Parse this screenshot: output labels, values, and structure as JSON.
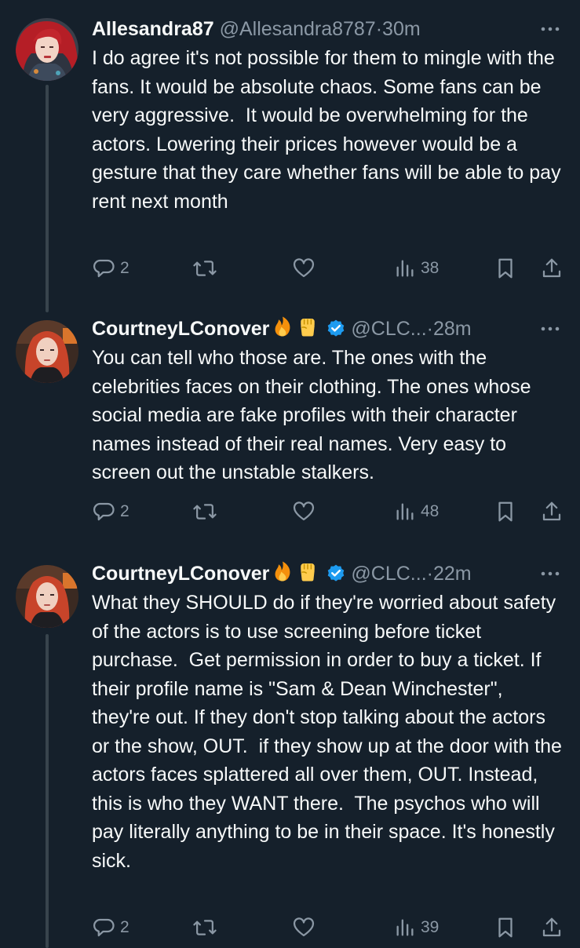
{
  "colors": {
    "background": "#15202b",
    "text": "#f7f9f9",
    "secondary_text": "#8b98a5",
    "verified_badge": "#1d9bf0",
    "thread_line": "#38444d"
  },
  "tweets": [
    {
      "display_name": "Allesandra87",
      "handle": "@Allesandra8787",
      "separator": "·",
      "time": "30m",
      "verified": false,
      "emojis": [],
      "text": "I do agree it's not possible for them to mingle with the fans. It would be absolute chaos. Some fans can be very aggressive.  It would be overwhelming for the actors. Lowering their prices however would be a gesture that they care whether fans will be able to pay rent next month",
      "replies": "2",
      "retweets": "",
      "likes": "",
      "views": "38"
    },
    {
      "display_name": "CourtneyLConover",
      "handle": "@CLC...",
      "separator": "·",
      "time": "28m",
      "verified": true,
      "emojis": [
        "fire-emoji",
        "raised-fist-emoji"
      ],
      "text": "You can tell who those are. The ones with the celebrities faces on their clothing. The ones whose social media are fake profiles with their character names instead of their real names. Very easy to screen out the unstable stalkers.",
      "replies": "2",
      "retweets": "",
      "likes": "",
      "views": "48"
    },
    {
      "display_name": "CourtneyLConover",
      "handle": "@CLC...",
      "separator": "·",
      "time": "22m",
      "verified": true,
      "emojis": [
        "fire-emoji",
        "raised-fist-emoji"
      ],
      "text": "What they SHOULD do if they're worried about safety of the actors is to use screening before ticket purchase.  Get permission in order to buy a ticket. If their profile name is \"Sam & Dean Winchester\", they're out. If they don't stop talking about the actors or the show, OUT.  if they show up at the door with the actors faces splattered all over them, OUT. Instead, this is who they WANT there.  The psychos who will pay literally anything to be in their space. It's honestly sick.",
      "replies": "2",
      "retweets": "",
      "likes": "",
      "views": "39"
    }
  ]
}
